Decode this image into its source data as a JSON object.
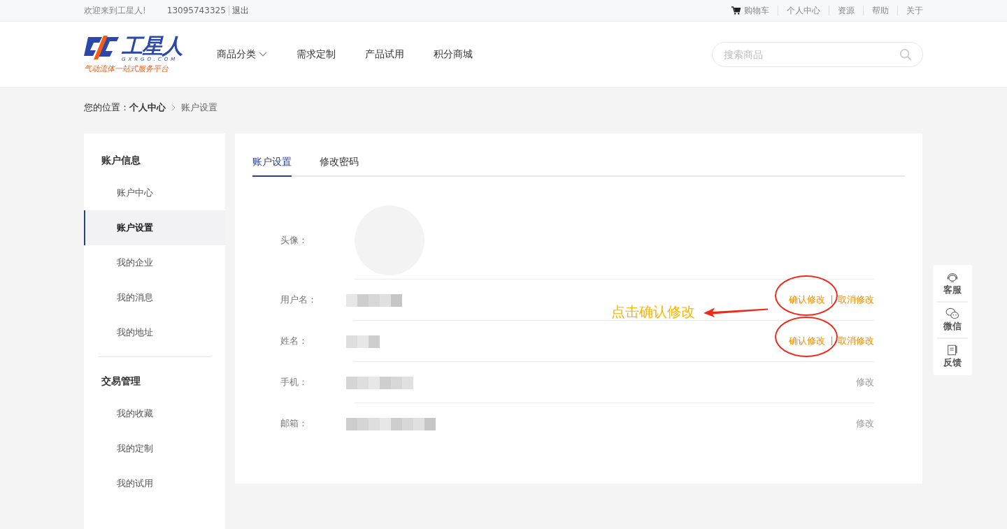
{
  "top_bar": {
    "welcome": "欢迎来到工星人!",
    "phone": "13095743325",
    "logout": "退出",
    "links": [
      {
        "label": "购物车",
        "kind": "cart"
      },
      {
        "label": "个人中心",
        "kind": "link"
      },
      {
        "label": "资源",
        "kind": "link"
      },
      {
        "label": "帮助",
        "kind": "link"
      },
      {
        "label": "关于",
        "kind": "link"
      }
    ]
  },
  "header": {
    "logo": {
      "name": "工星人",
      "domain": "GXRGO.COM",
      "slogan": "气动流体一站式服务平台"
    },
    "nav": [
      {
        "label": "商品分类",
        "dropdown": true
      },
      {
        "label": "需求定制",
        "dropdown": false
      },
      {
        "label": "产品试用",
        "dropdown": false
      },
      {
        "label": "积分商城",
        "dropdown": false
      }
    ],
    "search": {
      "placeholder": "搜索商品"
    }
  },
  "breadcrumb": {
    "prefix": "您的位置：",
    "items": [
      "个人中心",
      "账户设置"
    ]
  },
  "sidebar": {
    "sections": [
      {
        "title": "账户信息",
        "items": [
          {
            "label": "账户中心",
            "selected": false
          },
          {
            "label": "账户设置",
            "selected": true
          },
          {
            "label": "我的企业",
            "selected": false
          },
          {
            "label": "我的消息",
            "selected": false
          },
          {
            "label": "我的地址",
            "selected": false
          }
        ]
      },
      {
        "title": "交易管理",
        "items": [
          {
            "label": "我的收藏",
            "selected": false
          },
          {
            "label": "我的定制",
            "selected": false
          },
          {
            "label": "我的试用",
            "selected": false
          }
        ]
      }
    ]
  },
  "tabs": [
    {
      "label": "账户设置",
      "selected": true
    },
    {
      "label": "修改密码",
      "selected": false
    }
  ],
  "profile": {
    "avatar_label": "头像：",
    "rows": [
      {
        "label": "用户名：",
        "blurred": true,
        "editing": true,
        "circled": true,
        "actions": [
          "确认修改",
          "取消修改"
        ]
      },
      {
        "label": "姓名：",
        "blurred": true,
        "editing": true,
        "circled": true,
        "actions": [
          "确认修改",
          "取消修改"
        ]
      },
      {
        "label": "手机：",
        "blurred": true,
        "editing": false,
        "circled": false,
        "actions": [
          "修改"
        ]
      },
      {
        "label": "邮箱：",
        "blurred": true,
        "editing": false,
        "circled": false,
        "actions": [
          "修改"
        ]
      }
    ]
  },
  "annotation": {
    "text": "点击确认修改"
  },
  "float_bar": [
    {
      "label": "客服",
      "kind": "headset"
    },
    {
      "label": "微信",
      "kind": "chat"
    },
    {
      "label": "反馈",
      "kind": "feedback"
    }
  ]
}
